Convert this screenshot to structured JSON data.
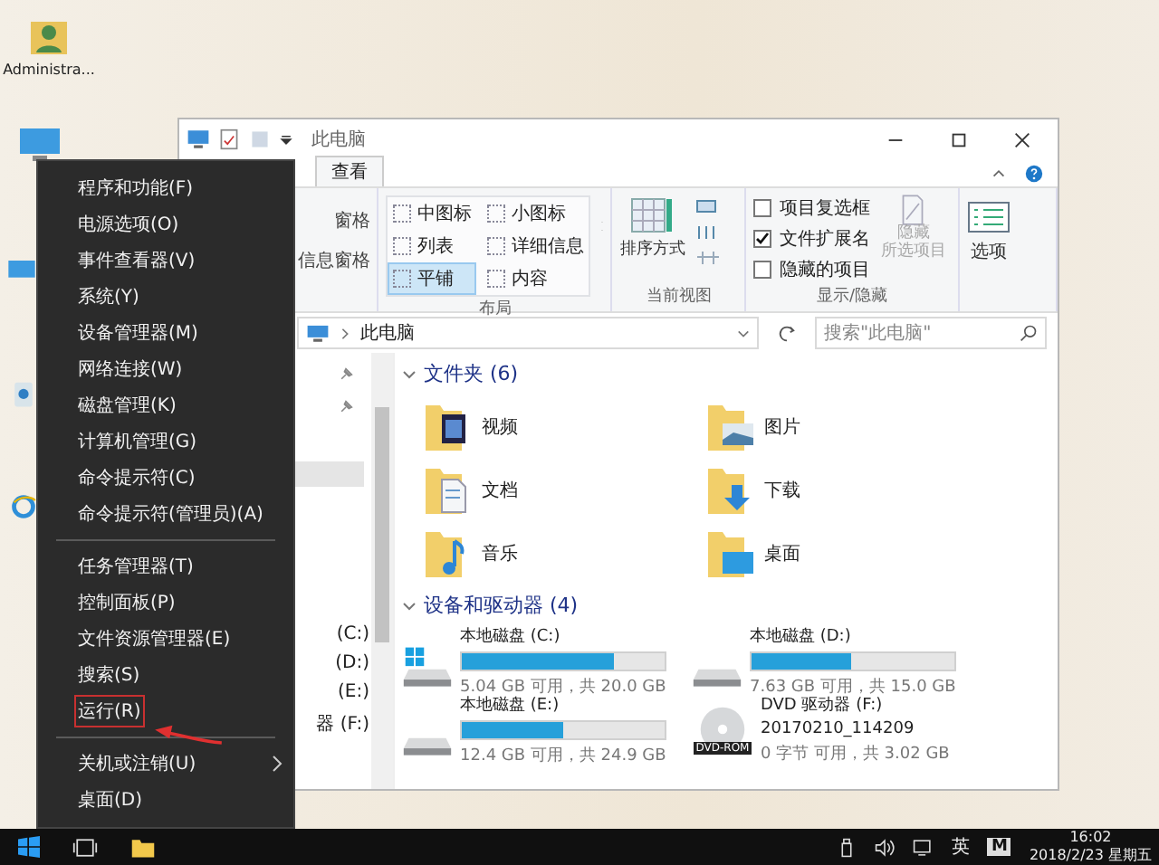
{
  "desktop": {
    "icons": [
      {
        "label": "Administra..."
      }
    ]
  },
  "explorer": {
    "title": "此电脑",
    "tabs": [
      {
        "label": "查看",
        "selected": true
      }
    ],
    "ribbon": {
      "panes": [
        "窗格",
        "信息窗格"
      ],
      "layouts": [
        {
          "label": "中图标",
          "selected": false
        },
        {
          "label": "小图标",
          "selected": false
        },
        {
          "label": "列表",
          "selected": false
        },
        {
          "label": "详细信息",
          "selected": false
        },
        {
          "label": "平铺",
          "selected": true
        },
        {
          "label": "内容",
          "selected": false
        }
      ],
      "layout_label": "布局",
      "sort": "排序方式",
      "view_label": "当前视图",
      "checks": [
        {
          "label": "项目复选框",
          "checked": false
        },
        {
          "label": "文件扩展名",
          "checked": true
        },
        {
          "label": "隐藏的项目",
          "checked": false
        }
      ],
      "hide_button": {
        "lines": [
          "隐藏",
          "所选项目"
        ],
        "disabled": true
      },
      "show_label": "显示/隐藏",
      "options": "选项"
    },
    "address": "此电脑",
    "search_placeholder": "搜索\"此电脑\"",
    "nav": [
      "(C:)",
      "(D:)",
      "(E:)",
      "器 (F:)"
    ],
    "folders_header": "文件夹 (6)",
    "folders": [
      {
        "name": "视频",
        "kind": "video"
      },
      {
        "name": "图片",
        "kind": "pictures"
      },
      {
        "name": "文档",
        "kind": "documents"
      },
      {
        "name": "下载",
        "kind": "downloads"
      },
      {
        "name": "音乐",
        "kind": "music"
      },
      {
        "name": "桌面",
        "kind": "desktop"
      }
    ],
    "drives_header": "设备和驱动器 (4)",
    "drives": [
      {
        "kind": "disk",
        "system": true,
        "name": "本地磁盘 (C:)",
        "level": 0.75,
        "free": "5.04 GB 可用，共 20.0 GB"
      },
      {
        "kind": "disk",
        "system": false,
        "name": "本地磁盘 (D:)",
        "level": 0.49,
        "free": "7.63 GB 可用，共 15.0 GB"
      },
      {
        "kind": "disk",
        "system": false,
        "name": "本地磁盘 (E:)",
        "level": 0.5,
        "free": "12.4 GB 可用，共 24.9 GB"
      },
      {
        "kind": "dvd",
        "name": "DVD 驱动器 (F:)",
        "volume": "20170210_114209",
        "badge": "DVD-ROM",
        "free": "0 字节 可用，共 3.02 GB"
      }
    ]
  },
  "power_menu": {
    "groups": [
      [
        {
          "label": "程序和功能(F)",
          "marked": false,
          "submenu": false
        },
        {
          "label": "电源选项(O)",
          "marked": false,
          "submenu": false
        },
        {
          "label": "事件查看器(V)",
          "marked": false,
          "submenu": false
        },
        {
          "label": "系统(Y)",
          "marked": false,
          "submenu": false
        },
        {
          "label": "设备管理器(M)",
          "marked": false,
          "submenu": false
        },
        {
          "label": "网络连接(W)",
          "marked": false,
          "submenu": false
        },
        {
          "label": "磁盘管理(K)",
          "marked": false,
          "submenu": false
        },
        {
          "label": "计算机管理(G)",
          "marked": false,
          "submenu": false
        },
        {
          "label": "命令提示符(C)",
          "marked": false,
          "submenu": false
        },
        {
          "label": "命令提示符(管理员)(A)",
          "marked": false,
          "submenu": false
        }
      ],
      [
        {
          "label": "任务管理器(T)",
          "marked": false,
          "submenu": false
        },
        {
          "label": "控制面板(P)",
          "marked": false,
          "submenu": false
        },
        {
          "label": "文件资源管理器(E)",
          "marked": false,
          "submenu": false
        },
        {
          "label": "搜索(S)",
          "marked": false,
          "submenu": false
        },
        {
          "label": "运行(R)",
          "marked": true,
          "submenu": false
        }
      ],
      [
        {
          "label": "关机或注销(U)",
          "marked": false,
          "submenu": true
        },
        {
          "label": "桌面(D)",
          "marked": false,
          "submenu": false
        }
      ]
    ]
  },
  "taskbar": {
    "ime": "英",
    "input_mode": "M",
    "time": "16:02",
    "date": "2018/2/23 星期五"
  }
}
